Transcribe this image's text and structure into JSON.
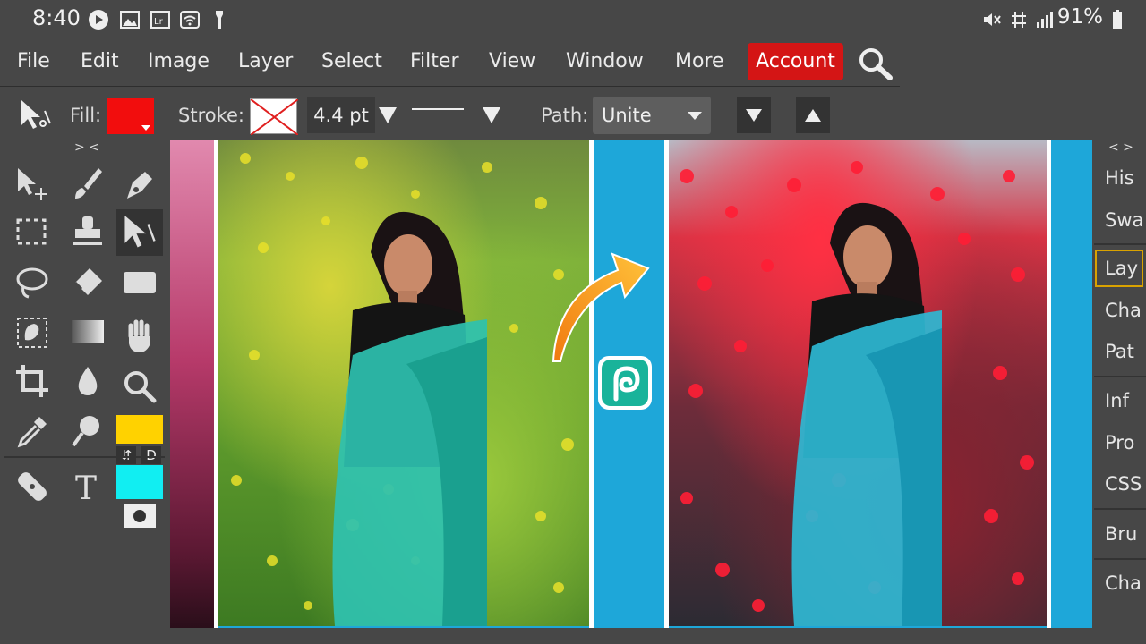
{
  "status_bar": {
    "time": "8:40",
    "battery": "91%",
    "icons": [
      "youtube-icon",
      "gallery-icon",
      "lightroom-icon",
      "wifi-icon",
      "flashlight-icon",
      "mute-icon",
      "data-icon",
      "signal-icon",
      "battery-icon"
    ]
  },
  "menubar": {
    "items": [
      "File",
      "Edit",
      "Image",
      "Layer",
      "Select",
      "Filter",
      "View",
      "Window",
      "More"
    ],
    "account_label": "Account"
  },
  "options_bar": {
    "fill_label": "Fill:",
    "stroke_label": "Stroke:",
    "stroke_width": "4.4 pt",
    "path_label": "Path:",
    "path_value": "Unite",
    "fill_color": "#f20d0d"
  },
  "tool_panel": {
    "collapse_glyph": "> <",
    "swap_glyph": "⇵",
    "default_glyph": "D",
    "foreground_color": "#ffd200",
    "background_color": "#11eef2"
  },
  "right_panel": {
    "collapse_glyph": "< >",
    "tabs": [
      "His",
      "Swa",
      "Lay",
      "Cha",
      "Pat",
      "Inf",
      "Pro",
      "CSS",
      "Bru",
      "Cha"
    ]
  },
  "colors": {
    "accent": "#d41515",
    "canvas_bg": "#1ea7d9",
    "ui_bg": "#474747"
  }
}
